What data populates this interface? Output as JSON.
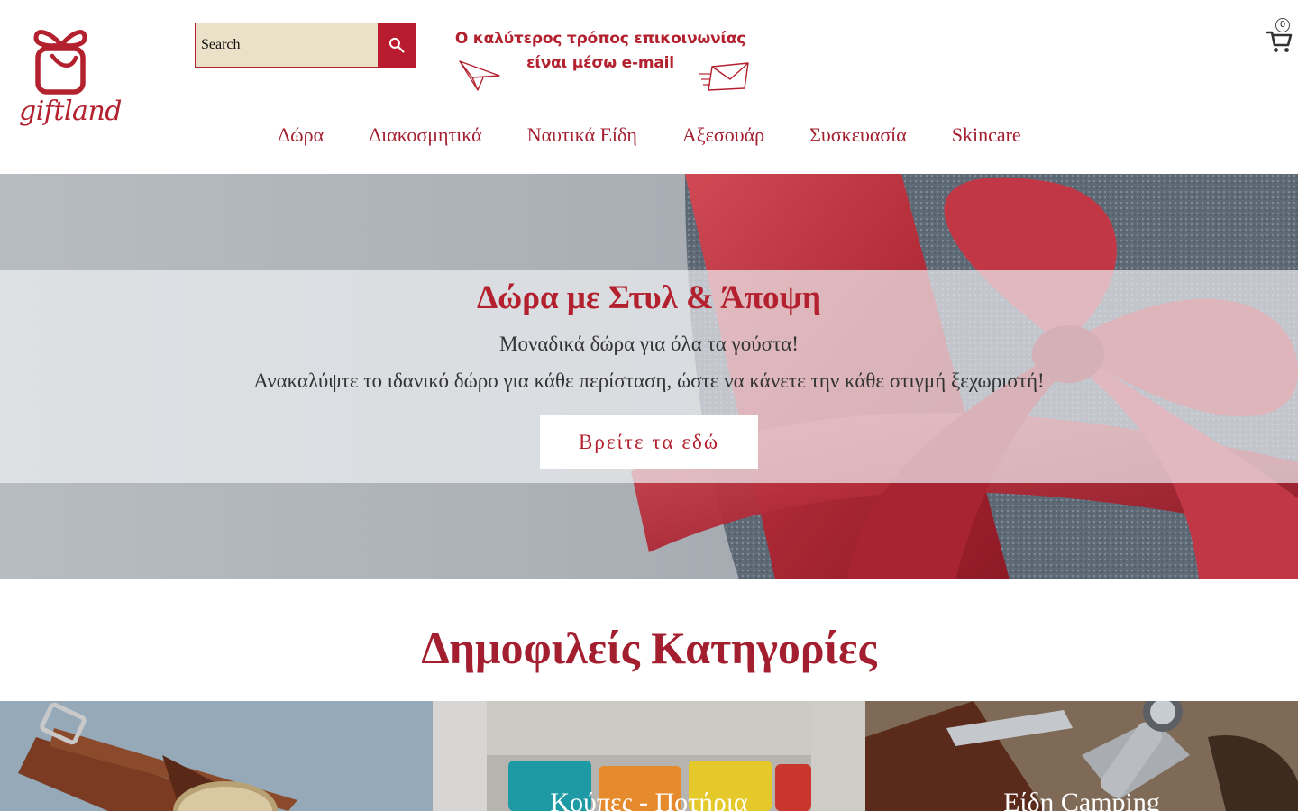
{
  "brand": {
    "name": "giftland",
    "accent": "#b3202e"
  },
  "search": {
    "placeholder": "Search",
    "button_icon": "search-icon"
  },
  "promo": {
    "line1": "Ο καλύτερος τρόπος επικοινωνίας",
    "line2": "είναι μέσω e-mail"
  },
  "cart": {
    "count": "0",
    "icon": "cart-icon"
  },
  "nav": {
    "items": [
      {
        "label": "Δώρα"
      },
      {
        "label": "Διακοσμητικά"
      },
      {
        "label": "Ναυτικά Είδη"
      },
      {
        "label": "Αξεσουάρ"
      },
      {
        "label": "Συσκευασία"
      },
      {
        "label": "Skincare"
      }
    ]
  },
  "hero": {
    "title": "Δώρα με Στυλ & Άποψη",
    "subtitle1": "Μοναδικά δώρα για όλα τα γούστα!",
    "subtitle2": "Ανακαλύψτε το ιδανικό δώρο για κάθε περίσταση, ώστε να κάνετε την κάθε στιγμή ξεχωριστή!",
    "cta_label": "Βρείτε τα εδώ"
  },
  "categories": {
    "heading": "Δημοφιλείς Κατηγορίες",
    "items": [
      {
        "label": ""
      },
      {
        "label": "Κούπες - Ποτήρια"
      },
      {
        "label": "Είδη Camping"
      }
    ]
  }
}
